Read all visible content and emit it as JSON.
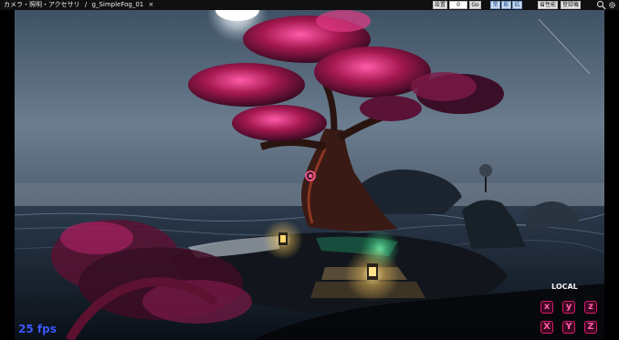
{
  "topbar": {
    "breadcrumb_root": "カメラ・照明・アクセサリ",
    "separator": "/",
    "tab_name": "g_SimpleFog_01",
    "tab_close": "×",
    "label_setting": "設置",
    "input_value": "0",
    "go_label": "Go",
    "toggle_1": "常",
    "toggle_2": "影",
    "toggle_3": "拡",
    "perf_button": "省性能",
    "register_button": "登録機"
  },
  "viewport": {
    "fps_text": "25 fps",
    "gizmo_mode": "LOCAL",
    "gizmo_rotate_x": "x",
    "gizmo_rotate_y": "y",
    "gizmo_rotate_z": "z",
    "gizmo_move_x": "X",
    "gizmo_move_y": "Y",
    "gizmo_move_z": "Z"
  },
  "icons": {
    "search": "search-icon",
    "settings": "gear-icon"
  },
  "colors": {
    "fps": "#3a5aff",
    "gizmo_accent": "#d61a6a",
    "tree_foliage": "#c21e63",
    "sky": "#6b7d8f"
  }
}
